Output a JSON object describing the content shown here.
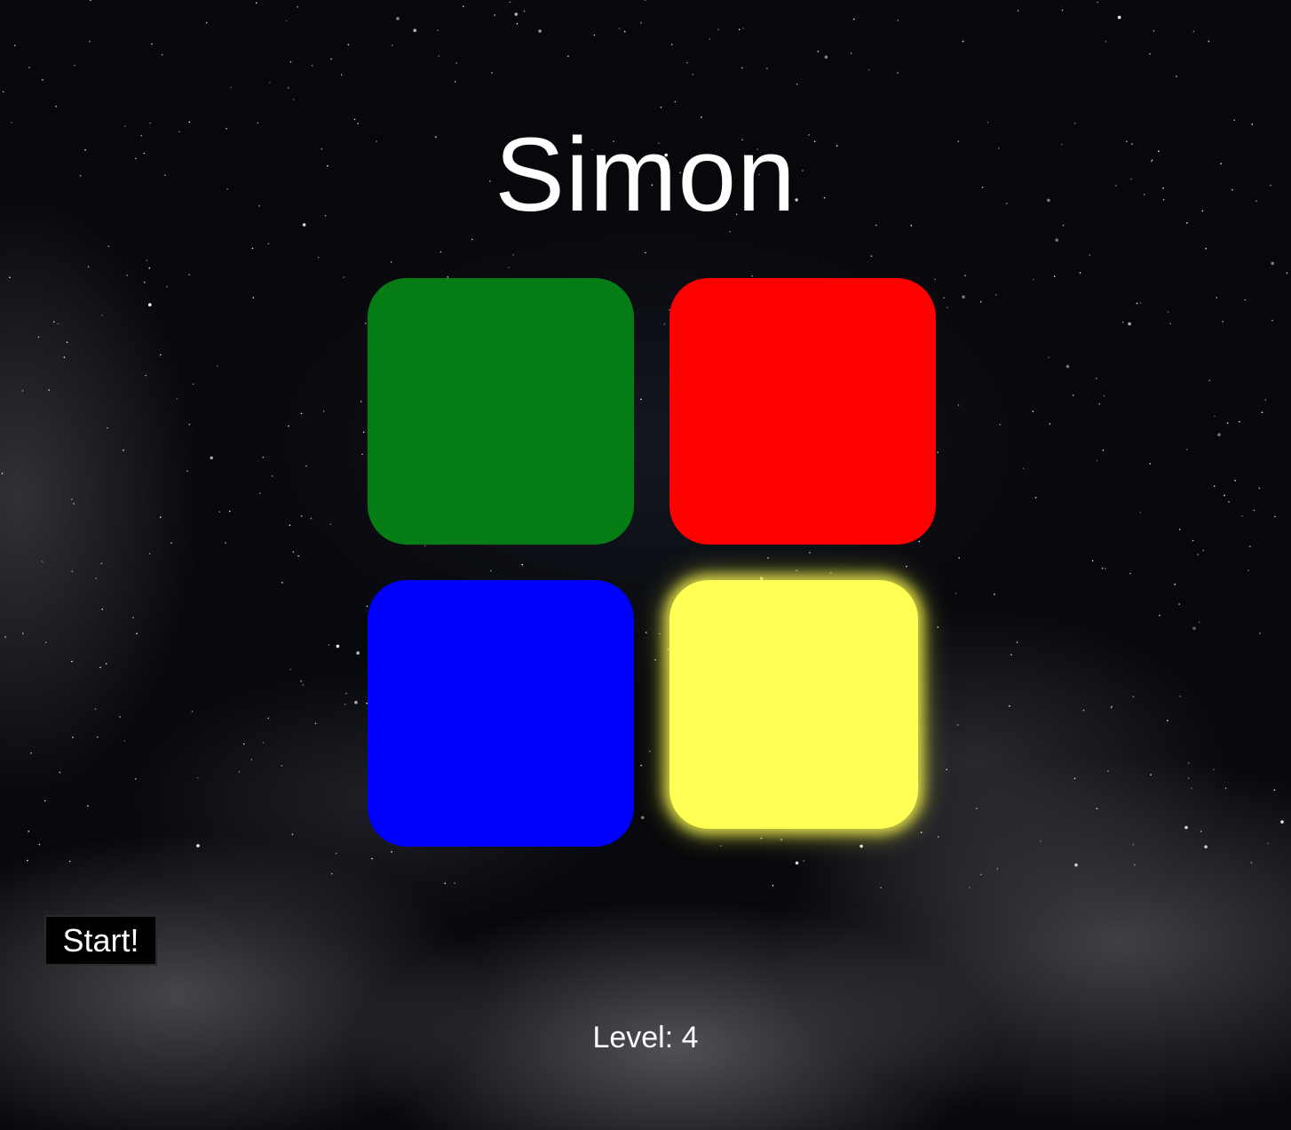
{
  "game": {
    "title": "Simon"
  },
  "pads": [
    {
      "name": "green",
      "color": "#057c14",
      "lit": false
    },
    {
      "name": "red",
      "color": "#ff0000",
      "lit": false
    },
    {
      "name": "blue",
      "color": "#0000ff",
      "lit": false
    },
    {
      "name": "yellow",
      "color": "#ffff55",
      "lit": true
    }
  ],
  "controls": {
    "start_label": "Start!"
  },
  "status": {
    "level_text": "Level: 4"
  }
}
